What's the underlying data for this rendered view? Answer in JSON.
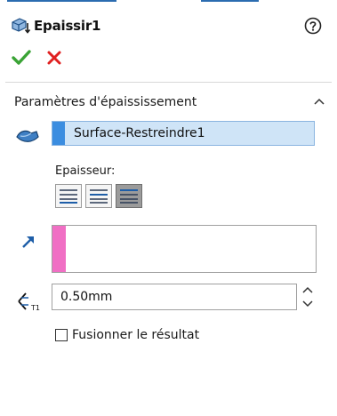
{
  "header": {
    "title": "Epaissir1",
    "icon": "thicken-feature-icon"
  },
  "actions": {
    "ok": "check-icon",
    "cancel": "close-icon",
    "help": "help-icon"
  },
  "section": {
    "title": "Paramètres d'épaississement",
    "face_selection": {
      "value": "Surface-Restreindre1",
      "swatch_color": "#3b8de0"
    },
    "thicken_side": {
      "label": "Epaisseur:",
      "options": [
        "side-1",
        "both-sides",
        "side-2"
      ],
      "selected_index": 2
    },
    "direction_list": {
      "swatch_color": "#f06fc4"
    },
    "thickness": {
      "value": "0.50mm"
    },
    "merge": {
      "label": "Fusionner le résultat",
      "checked": false
    }
  },
  "colors": {
    "ok": "#3aa335",
    "cancel": "#e02020",
    "accent": "#2b6cb0",
    "selection_bg": "#cfe4f7"
  }
}
